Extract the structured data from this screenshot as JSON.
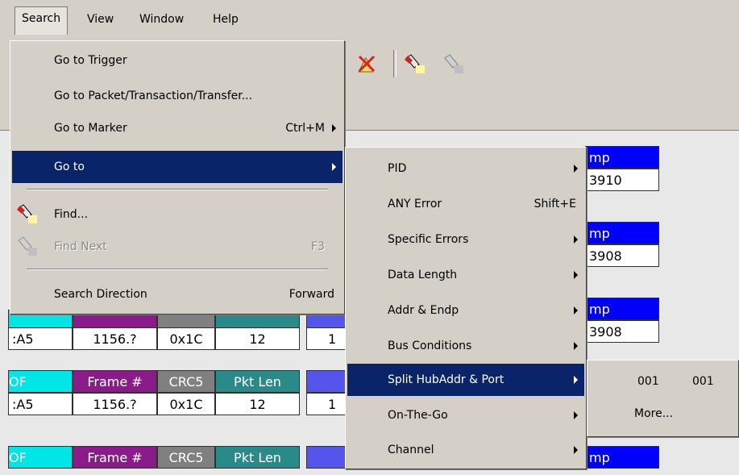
{
  "menubar": {
    "items": [
      "Search",
      "View",
      "Window",
      "Help"
    ]
  },
  "search_menu": {
    "items": [
      {
        "label": "Go to Trigger",
        "shortcut": "",
        "submenu": false
      },
      {
        "label": "Go to Packet/Transaction/Transfer...",
        "shortcut": "",
        "submenu": false
      },
      {
        "label": "Go to Marker",
        "shortcut": "Ctrl+M",
        "submenu": true
      },
      {
        "label": "Go to",
        "shortcut": "",
        "submenu": true,
        "highlighted": true
      },
      {
        "label": "Find...",
        "shortcut": "",
        "submenu": false,
        "icon": "flashlight-icon"
      },
      {
        "label": "Find Next",
        "shortcut": "F3",
        "submenu": false,
        "disabled": true,
        "icon": "flashlight-next-icon"
      },
      {
        "label": "Search Direction",
        "shortcut": "Forward",
        "submenu": false
      }
    ]
  },
  "goto_menu": {
    "items": [
      {
        "label": "PID",
        "shortcut": "",
        "submenu": true
      },
      {
        "label": "ANY Error",
        "shortcut": "Shift+E",
        "submenu": false
      },
      {
        "label": "Specific Errors",
        "shortcut": "",
        "submenu": true
      },
      {
        "label": "Data Length",
        "shortcut": "",
        "submenu": true
      },
      {
        "label": "Addr & Endp",
        "shortcut": "",
        "submenu": true
      },
      {
        "label": "Bus Conditions",
        "shortcut": "",
        "submenu": true
      },
      {
        "label": "Split HubAddr & Port",
        "shortcut": "",
        "submenu": true,
        "highlighted": true
      },
      {
        "label": "On-The-Go",
        "shortcut": "",
        "submenu": true
      },
      {
        "label": "Channel",
        "shortcut": "",
        "submenu": true
      }
    ]
  },
  "split_menu": {
    "items": [
      {
        "col1": "001",
        "col2": "001"
      },
      {
        "col1": "More...",
        "col2": ""
      }
    ]
  },
  "trace": {
    "rows": [
      {
        "sof": ":A5",
        "frame": "1156.?",
        "crc": "0x1C",
        "pktlen": "12",
        "extra": "1",
        "stamp_hdr": "mp",
        "stamp": "3910"
      },
      {
        "sof": ":A5",
        "frame": "1156.?",
        "crc": "0x1C",
        "pktlen": "12",
        "extra": "1",
        "stamp_hdr": "mp",
        "stamp": "3908"
      },
      {
        "sof": "",
        "frame": "",
        "crc": "",
        "pktlen": "",
        "extra": "",
        "stamp_hdr": "mp",
        "stamp": "3908"
      }
    ],
    "headers": {
      "sof": "OF",
      "frame": "Frame #",
      "crc": "CRC5",
      "pktlen": "Pkt Len",
      "stamp": "mp"
    }
  },
  "colors": {
    "menu_bg": "#d4d0c8",
    "highlight": "#0a246a",
    "sof_hdr": "#00e5e5",
    "frame_hdr": "#8b1a8b",
    "crc_hdr": "#808080",
    "pktlen_hdr": "#2a8a8a",
    "blue_hdr": "#5555ee",
    "stamp_hdr": "#0000ff"
  }
}
